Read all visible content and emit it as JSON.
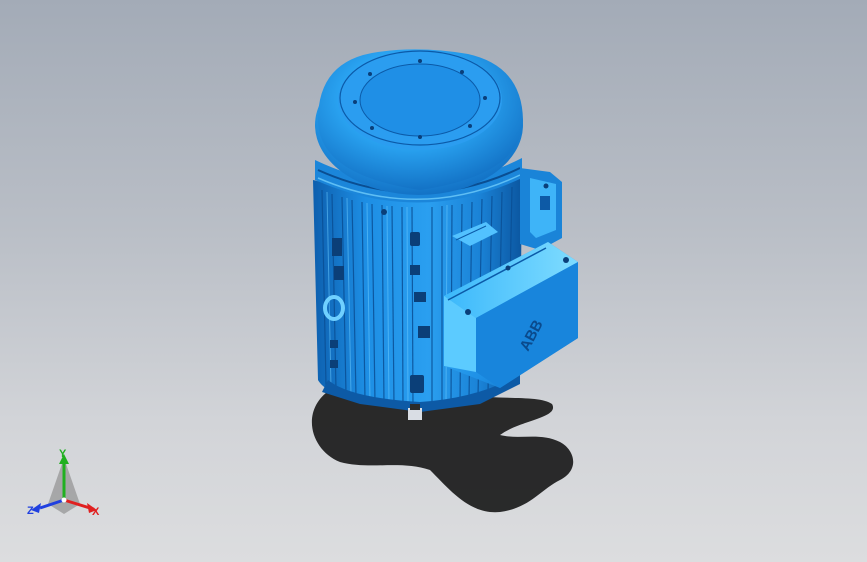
{
  "viewport": {
    "background_top": "#a3abb7",
    "background_bottom": "#dcdddf"
  },
  "model": {
    "body_color": "#1e8fe6",
    "highlight_color": "#5cc8ff",
    "dark_color": "#0a5aa8",
    "shadow_color": "#1a1a1a",
    "nameplate_text": "ABB"
  },
  "triad": {
    "x_label": "X",
    "y_label": "Y",
    "z_label": "Z",
    "x_color": "#e02020",
    "y_color": "#20b020",
    "z_color": "#2040e0"
  }
}
